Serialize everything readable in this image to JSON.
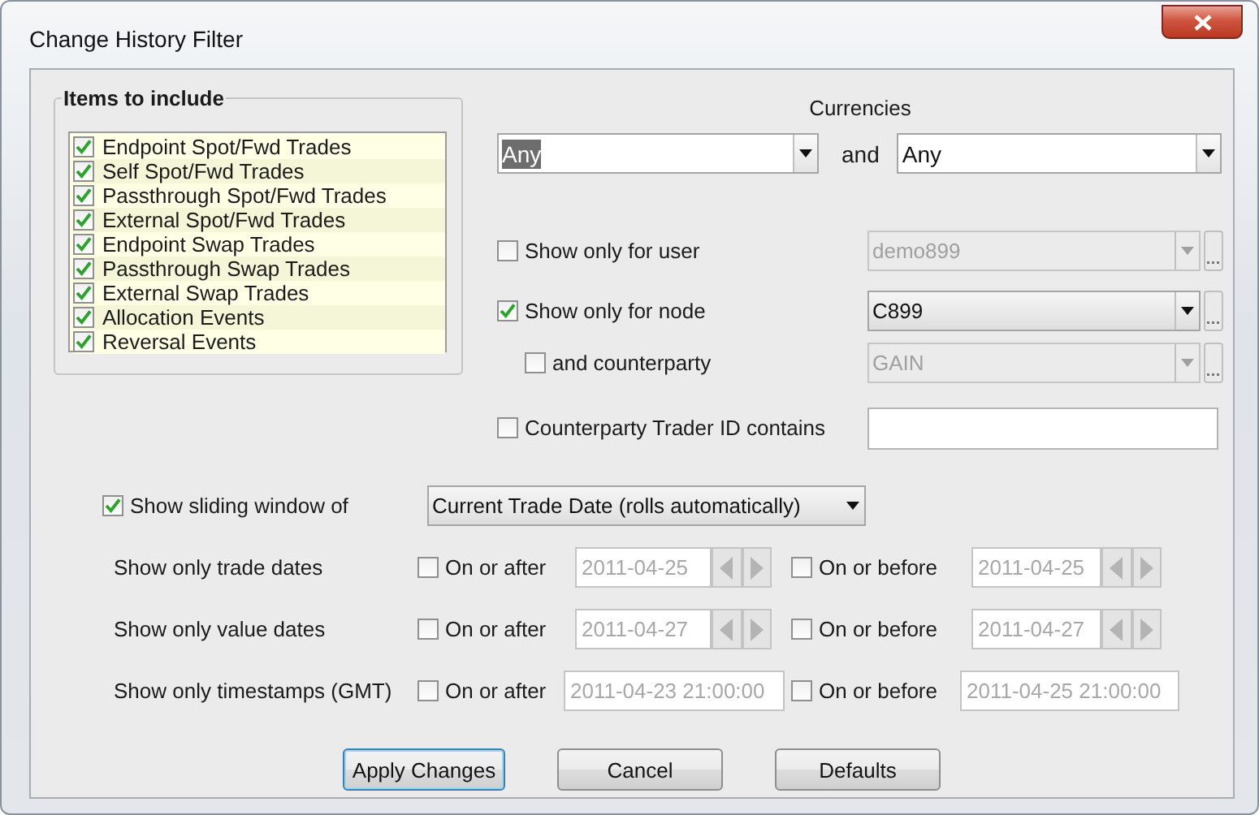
{
  "window": {
    "title": "Change History Filter"
  },
  "items_group": {
    "title": "Items to include",
    "items": [
      {
        "label": "Endpoint Spot/Fwd Trades",
        "checked": true
      },
      {
        "label": "Self Spot/Fwd Trades",
        "checked": true
      },
      {
        "label": "Passthrough Spot/Fwd Trades",
        "checked": true
      },
      {
        "label": "External Spot/Fwd Trades",
        "checked": true
      },
      {
        "label": "Endpoint Swap Trades",
        "checked": true
      },
      {
        "label": "Passthrough Swap Trades",
        "checked": true
      },
      {
        "label": "External Swap Trades",
        "checked": true
      },
      {
        "label": "Allocation Events",
        "checked": true
      },
      {
        "label": "Reversal Events",
        "checked": true
      }
    ]
  },
  "currencies": {
    "label": "Currencies",
    "joiner": "and",
    "pickers": [
      {
        "value": "Any",
        "highlighted": true
      },
      {
        "value": "Any",
        "highlighted": false
      }
    ]
  },
  "filters": [
    {
      "kind": "combo",
      "label": "Show only for user",
      "checked": false,
      "indented": false,
      "value": "demo899",
      "disabled": true
    },
    {
      "kind": "combo",
      "label": "Show only for node",
      "checked": true,
      "indented": false,
      "value": "C899",
      "disabled": false
    },
    {
      "kind": "combo",
      "label": "and counterparty",
      "checked": false,
      "indented": true,
      "value": "GAIN",
      "disabled": true
    },
    {
      "kind": "text",
      "label": "Counterparty Trader ID contains",
      "checked": false,
      "indented": false
    }
  ],
  "sliding_window": {
    "label": "Show sliding window of",
    "checked": true,
    "value": "Current Trade Date (rolls automatically)"
  },
  "date_filters": [
    {
      "kind": "date",
      "label": "Show only trade dates",
      "after": {
        "label": "On or after",
        "checked": false,
        "value": "2011-04-25",
        "disabled": true
      },
      "before": {
        "label": "On or before",
        "checked": false,
        "value": "2011-04-25",
        "disabled": true
      }
    },
    {
      "kind": "date",
      "label": "Show only value dates",
      "after": {
        "label": "On or after",
        "checked": false,
        "value": "2011-04-27",
        "disabled": true
      },
      "before": {
        "label": "On or before",
        "checked": false,
        "value": "2011-04-27",
        "disabled": true
      }
    },
    {
      "kind": "timestamp",
      "label": "Show only timestamps (GMT)",
      "after": {
        "label": "On or after",
        "checked": false,
        "value": "2011-04-23 21:00:00",
        "disabled": true
      },
      "before": {
        "label": "On or before",
        "checked": false,
        "value": "2011-04-25 21:00:00",
        "disabled": true
      }
    }
  ],
  "buttons": [
    {
      "label": "Apply Changes",
      "default": true
    },
    {
      "label": "Cancel",
      "default": false
    },
    {
      "label": "Defaults",
      "default": false
    }
  ]
}
